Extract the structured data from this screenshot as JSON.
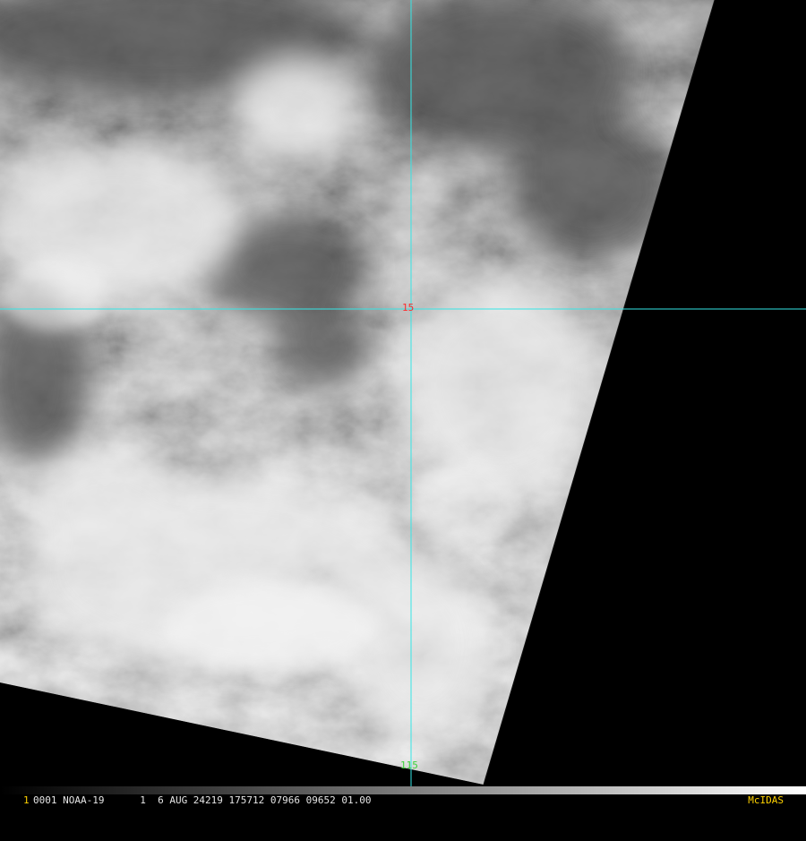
{
  "image": {
    "kind": "satellite-imagery",
    "palette": "grayscale cloud field with black no-data region",
    "colors": {
      "grid_lines": "#34e6e6",
      "lat_label": "#ff2a2a",
      "lon_label": "#3cd23c",
      "status_text": "#e6e6e6",
      "brand": "#ffd200",
      "no_data": "#000000"
    }
  },
  "grid": {
    "latitude_label": "15",
    "longitude_label": "115"
  },
  "status_bar": {
    "frame_number": "1",
    "text": "0001 NOAA-19      1  6 AUG 24219 175712 07966 09652 01.00",
    "brand": "McIDAS"
  }
}
